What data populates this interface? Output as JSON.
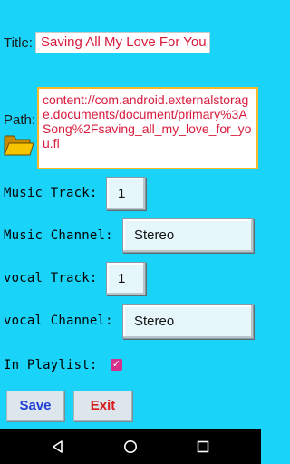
{
  "form": {
    "title_label": "Title:",
    "title_value": "Saving All My Love For You",
    "path_label": "Path:",
    "path_value": "content://com.android.externalstorage.documents/document/primary%3ASong%2Fsaving_all_my_love_for_you.fl",
    "music_track_label": "Music Track:",
    "music_track_value": "1",
    "music_channel_label": "Music Channel:",
    "music_channel_value": "Stereo",
    "vocal_track_label": "vocal Track:",
    "vocal_track_value": "1",
    "vocal_channel_label": "vocal Channel:",
    "vocal_channel_value": "Stereo",
    "playlist_label": "In Playlist:",
    "in_playlist": true
  },
  "buttons": {
    "save_label": "Save",
    "exit_label": "Exit"
  },
  "colors": {
    "background": "#1ad3f9",
    "text_accent": "#d81b3c",
    "save_text": "#1f3fd6",
    "exit_text": "#d81b1b",
    "checkbox": "#d6308a"
  },
  "icons": {
    "folder": "folder-icon",
    "nav_back": "back-icon",
    "nav_home": "home-icon",
    "nav_recents": "recents-icon"
  }
}
